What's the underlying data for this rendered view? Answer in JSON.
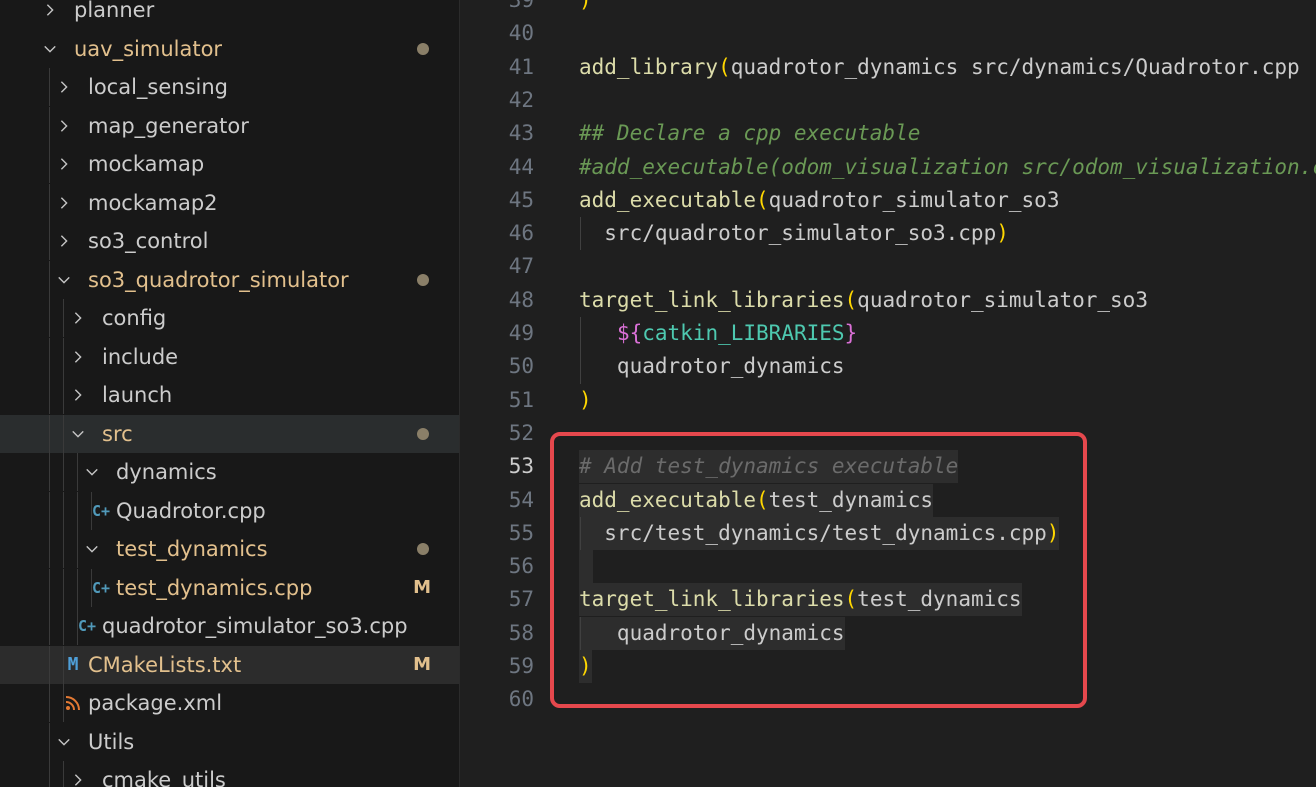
{
  "explorer": {
    "items": [
      {
        "label": "planner",
        "type": "folder",
        "expanded": false,
        "status": ""
      },
      {
        "label": "uav_simulator",
        "type": "folder",
        "expanded": true,
        "status": "dot"
      },
      {
        "label": "local_sensing",
        "type": "folder",
        "expanded": false,
        "status": ""
      },
      {
        "label": "map_generator",
        "type": "folder",
        "expanded": false,
        "status": ""
      },
      {
        "label": "mockamap",
        "type": "folder",
        "expanded": false,
        "status": ""
      },
      {
        "label": "mockamap2",
        "type": "folder",
        "expanded": false,
        "status": ""
      },
      {
        "label": "so3_control",
        "type": "folder",
        "expanded": false,
        "status": ""
      },
      {
        "label": "so3_quadrotor_simulator",
        "type": "folder",
        "expanded": true,
        "status": "dot"
      },
      {
        "label": "config",
        "type": "folder",
        "expanded": false,
        "status": ""
      },
      {
        "label": "include",
        "type": "folder",
        "expanded": false,
        "status": ""
      },
      {
        "label": "launch",
        "type": "folder",
        "expanded": false,
        "status": ""
      },
      {
        "label": "src",
        "type": "folder",
        "expanded": true,
        "status": "dot"
      },
      {
        "label": "dynamics",
        "type": "folder",
        "expanded": true,
        "status": ""
      },
      {
        "label": "Quadrotor.cpp",
        "type": "cpp",
        "status": ""
      },
      {
        "label": "test_dynamics",
        "type": "folder",
        "expanded": true,
        "status": "dot"
      },
      {
        "label": "test_dynamics.cpp",
        "type": "cpp",
        "status": "M"
      },
      {
        "label": "quadrotor_simulator_so3.cpp",
        "type": "cpp",
        "status": ""
      },
      {
        "label": "CMakeLists.txt",
        "type": "cmake",
        "status": "M"
      },
      {
        "label": "package.xml",
        "type": "xml",
        "status": ""
      },
      {
        "label": "Utils",
        "type": "folder",
        "expanded": true,
        "status": ""
      },
      {
        "label": "cmake_utils",
        "type": "folder",
        "expanded": false,
        "status": ""
      }
    ],
    "icons": {
      "cpp": "C+",
      "cmake": "M",
      "xml": "rss"
    }
  },
  "editor": {
    "lines": [
      {
        "n": "39",
        "t": [
          [
            "par",
            ")"
          ]
        ]
      },
      {
        "n": "40",
        "t": []
      },
      {
        "n": "41",
        "t": [
          [
            "fn",
            "add_library"
          ],
          [
            "par",
            "("
          ],
          [
            "",
            "quadrotor_dynamics src/dynamics/Quadrotor.cpp"
          ]
        ]
      },
      {
        "n": "42",
        "t": []
      },
      {
        "n": "43",
        "t": [
          [
            "cmt",
            "## Declare a cpp executable"
          ]
        ]
      },
      {
        "n": "44",
        "t": [
          [
            "cmt",
            "#add_executable(odom_visualization src/odom_visualization.cpp)"
          ]
        ]
      },
      {
        "n": "45",
        "t": [
          [
            "fn",
            "add_executable"
          ],
          [
            "par",
            "("
          ],
          [
            "",
            "quadrotor_simulator_so3"
          ]
        ]
      },
      {
        "n": "46",
        "t": [
          [
            "",
            "  src/quadrotor_simulator_so3.cpp"
          ],
          [
            "par",
            ")"
          ]
        ]
      },
      {
        "n": "47",
        "t": []
      },
      {
        "n": "48",
        "t": [
          [
            "fn",
            "target_link_libraries"
          ],
          [
            "par",
            "("
          ],
          [
            "",
            "quadrotor_simulator_so3"
          ]
        ]
      },
      {
        "n": "49",
        "t": [
          [
            "",
            "   "
          ],
          [
            "dol",
            "$"
          ],
          [
            "par2",
            "{"
          ],
          [
            "fnc",
            "catkin_LIBRARIES"
          ],
          [
            "par2",
            "}"
          ]
        ]
      },
      {
        "n": "50",
        "t": [
          [
            "",
            "   quadrotor_dynamics"
          ]
        ]
      },
      {
        "n": "51",
        "t": [
          [
            "par",
            ")"
          ]
        ]
      },
      {
        "n": "52",
        "t": []
      },
      {
        "n": "53",
        "t": [
          [
            "cmt2",
            "# Add test_dynamics executable"
          ]
        ]
      },
      {
        "n": "54",
        "t": [
          [
            "fn",
            "add_executable"
          ],
          [
            "par",
            "("
          ],
          [
            "",
            "test_dynamics"
          ]
        ]
      },
      {
        "n": "55",
        "t": [
          [
            "",
            "  src/test_dynamics/test_dynamics.cpp"
          ],
          [
            "par",
            ")"
          ]
        ]
      },
      {
        "n": "56",
        "t": []
      },
      {
        "n": "57",
        "t": [
          [
            "fn",
            "target_link_libraries"
          ],
          [
            "par",
            "("
          ],
          [
            "",
            "test_dynamics"
          ]
        ]
      },
      {
        "n": "58",
        "t": [
          [
            "",
            "   quadrotor_dynamics"
          ]
        ]
      },
      {
        "n": "59",
        "t": [
          [
            "par",
            ")"
          ]
        ]
      },
      {
        "n": "60",
        "t": []
      }
    ],
    "current_line": "53"
  },
  "colors": {
    "highlight_border": "#e5484d",
    "modified": "#e2c08d",
    "cpp_icon": "#519aba",
    "cmake_icon": "#4f9fd8",
    "xml_icon": "#e37933"
  }
}
